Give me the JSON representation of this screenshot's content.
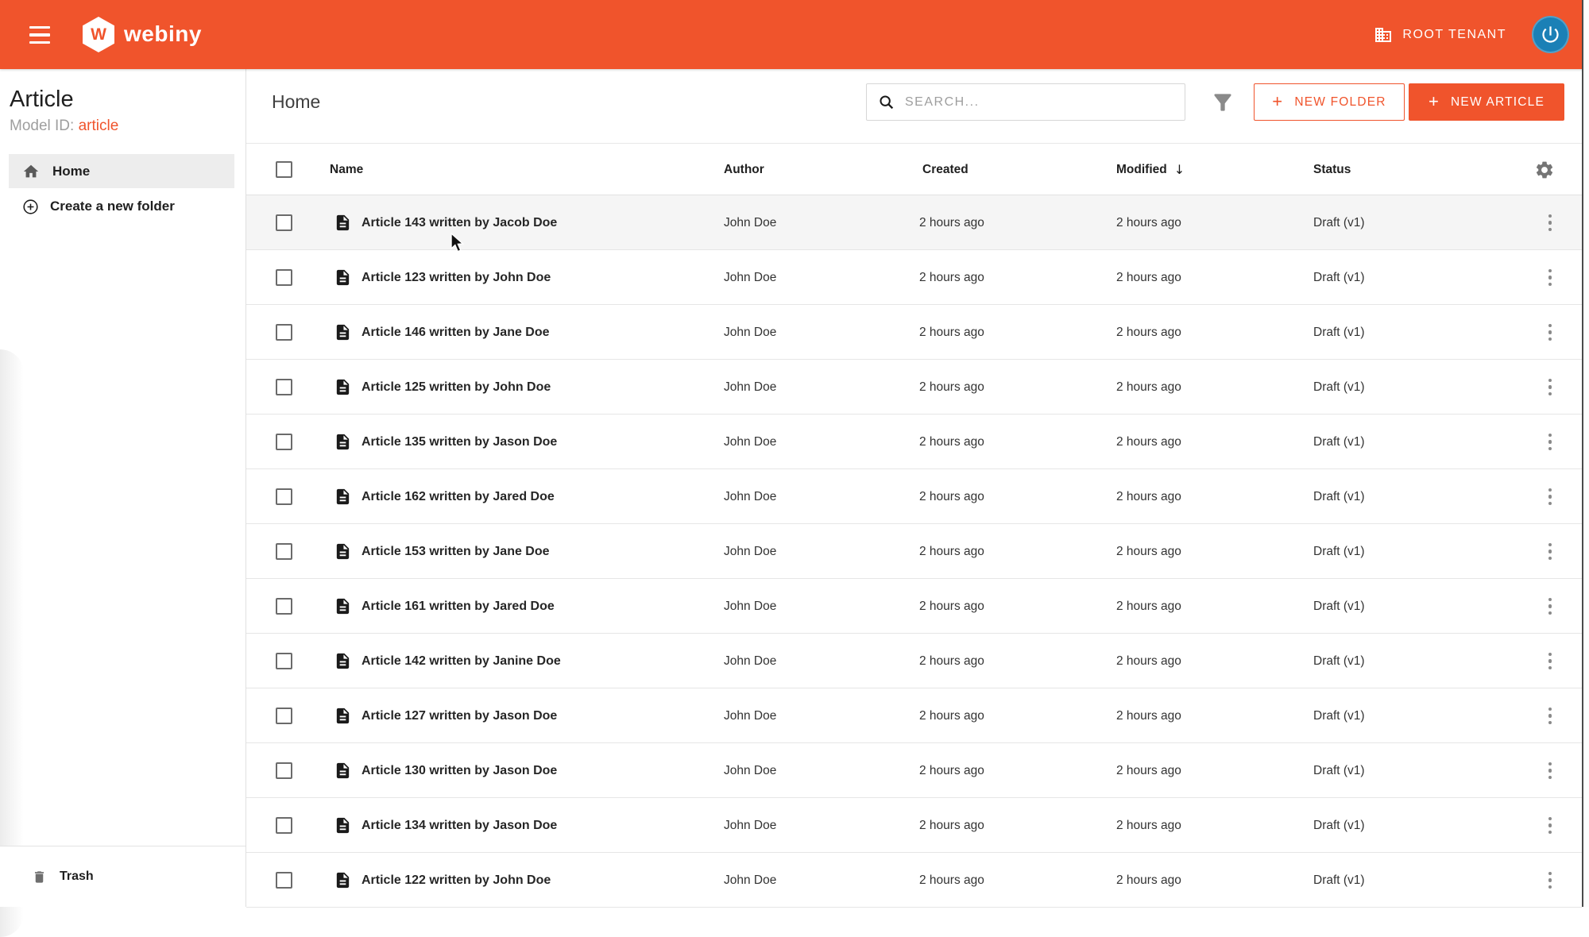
{
  "header": {
    "logo_letter": "W",
    "brand": "webiny",
    "tenant_label": "ROOT TENANT"
  },
  "sidebar": {
    "title": "Article",
    "model_id_label": "Model ID:",
    "model_id_value": "article",
    "home_label": "Home",
    "create_folder_label": "Create a new folder",
    "trash_label": "Trash"
  },
  "toolbar": {
    "title": "Home",
    "search_placeholder": "SEARCH...",
    "plus": "+",
    "new_folder_label": "NEW FOLDER",
    "new_article_label": "NEW ARTICLE"
  },
  "table": {
    "columns": {
      "name": "Name",
      "author": "Author",
      "created": "Created",
      "modified": "Modified",
      "status": "Status"
    },
    "sort_indicator": "↓",
    "sorted_column": "Modified",
    "rows": [
      {
        "name": "Article 143 written by Jacob Doe",
        "author": "John Doe",
        "created": "2 hours ago",
        "modified": "2 hours ago",
        "status": "Draft (v1)",
        "hovered": true
      },
      {
        "name": "Article 123 written by John Doe",
        "author": "John Doe",
        "created": "2 hours ago",
        "modified": "2 hours ago",
        "status": "Draft (v1)",
        "hovered": false
      },
      {
        "name": "Article 146 written by Jane Doe",
        "author": "John Doe",
        "created": "2 hours ago",
        "modified": "2 hours ago",
        "status": "Draft (v1)",
        "hovered": false
      },
      {
        "name": "Article 125 written by John Doe",
        "author": "John Doe",
        "created": "2 hours ago",
        "modified": "2 hours ago",
        "status": "Draft (v1)",
        "hovered": false
      },
      {
        "name": "Article 135 written by Jason Doe",
        "author": "John Doe",
        "created": "2 hours ago",
        "modified": "2 hours ago",
        "status": "Draft (v1)",
        "hovered": false
      },
      {
        "name": "Article 162 written by Jared Doe",
        "author": "John Doe",
        "created": "2 hours ago",
        "modified": "2 hours ago",
        "status": "Draft (v1)",
        "hovered": false
      },
      {
        "name": "Article 153 written by Jane Doe",
        "author": "John Doe",
        "created": "2 hours ago",
        "modified": "2 hours ago",
        "status": "Draft (v1)",
        "hovered": false
      },
      {
        "name": "Article 161 written by Jared Doe",
        "author": "John Doe",
        "created": "2 hours ago",
        "modified": "2 hours ago",
        "status": "Draft (v1)",
        "hovered": false
      },
      {
        "name": "Article 142 written by Janine Doe",
        "author": "John Doe",
        "created": "2 hours ago",
        "modified": "2 hours ago",
        "status": "Draft (v1)",
        "hovered": false
      },
      {
        "name": "Article 127 written by Jason Doe",
        "author": "John Doe",
        "created": "2 hours ago",
        "modified": "2 hours ago",
        "status": "Draft (v1)",
        "hovered": false
      },
      {
        "name": "Article 130 written by Jason Doe",
        "author": "John Doe",
        "created": "2 hours ago",
        "modified": "2 hours ago",
        "status": "Draft (v1)",
        "hovered": false
      },
      {
        "name": "Article 134 written by Jason Doe",
        "author": "John Doe",
        "created": "2 hours ago",
        "modified": "2 hours ago",
        "status": "Draft (v1)",
        "hovered": false
      },
      {
        "name": "Article 122 written by John Doe",
        "author": "John Doe",
        "created": "2 hours ago",
        "modified": "2 hours ago",
        "status": "Draft (v1)",
        "hovered": false
      }
    ]
  },
  "colors": {
    "primary_orange": "#F0542C",
    "avatar_blue": "#1B80B6",
    "hover_row": "#f5f5f5"
  }
}
